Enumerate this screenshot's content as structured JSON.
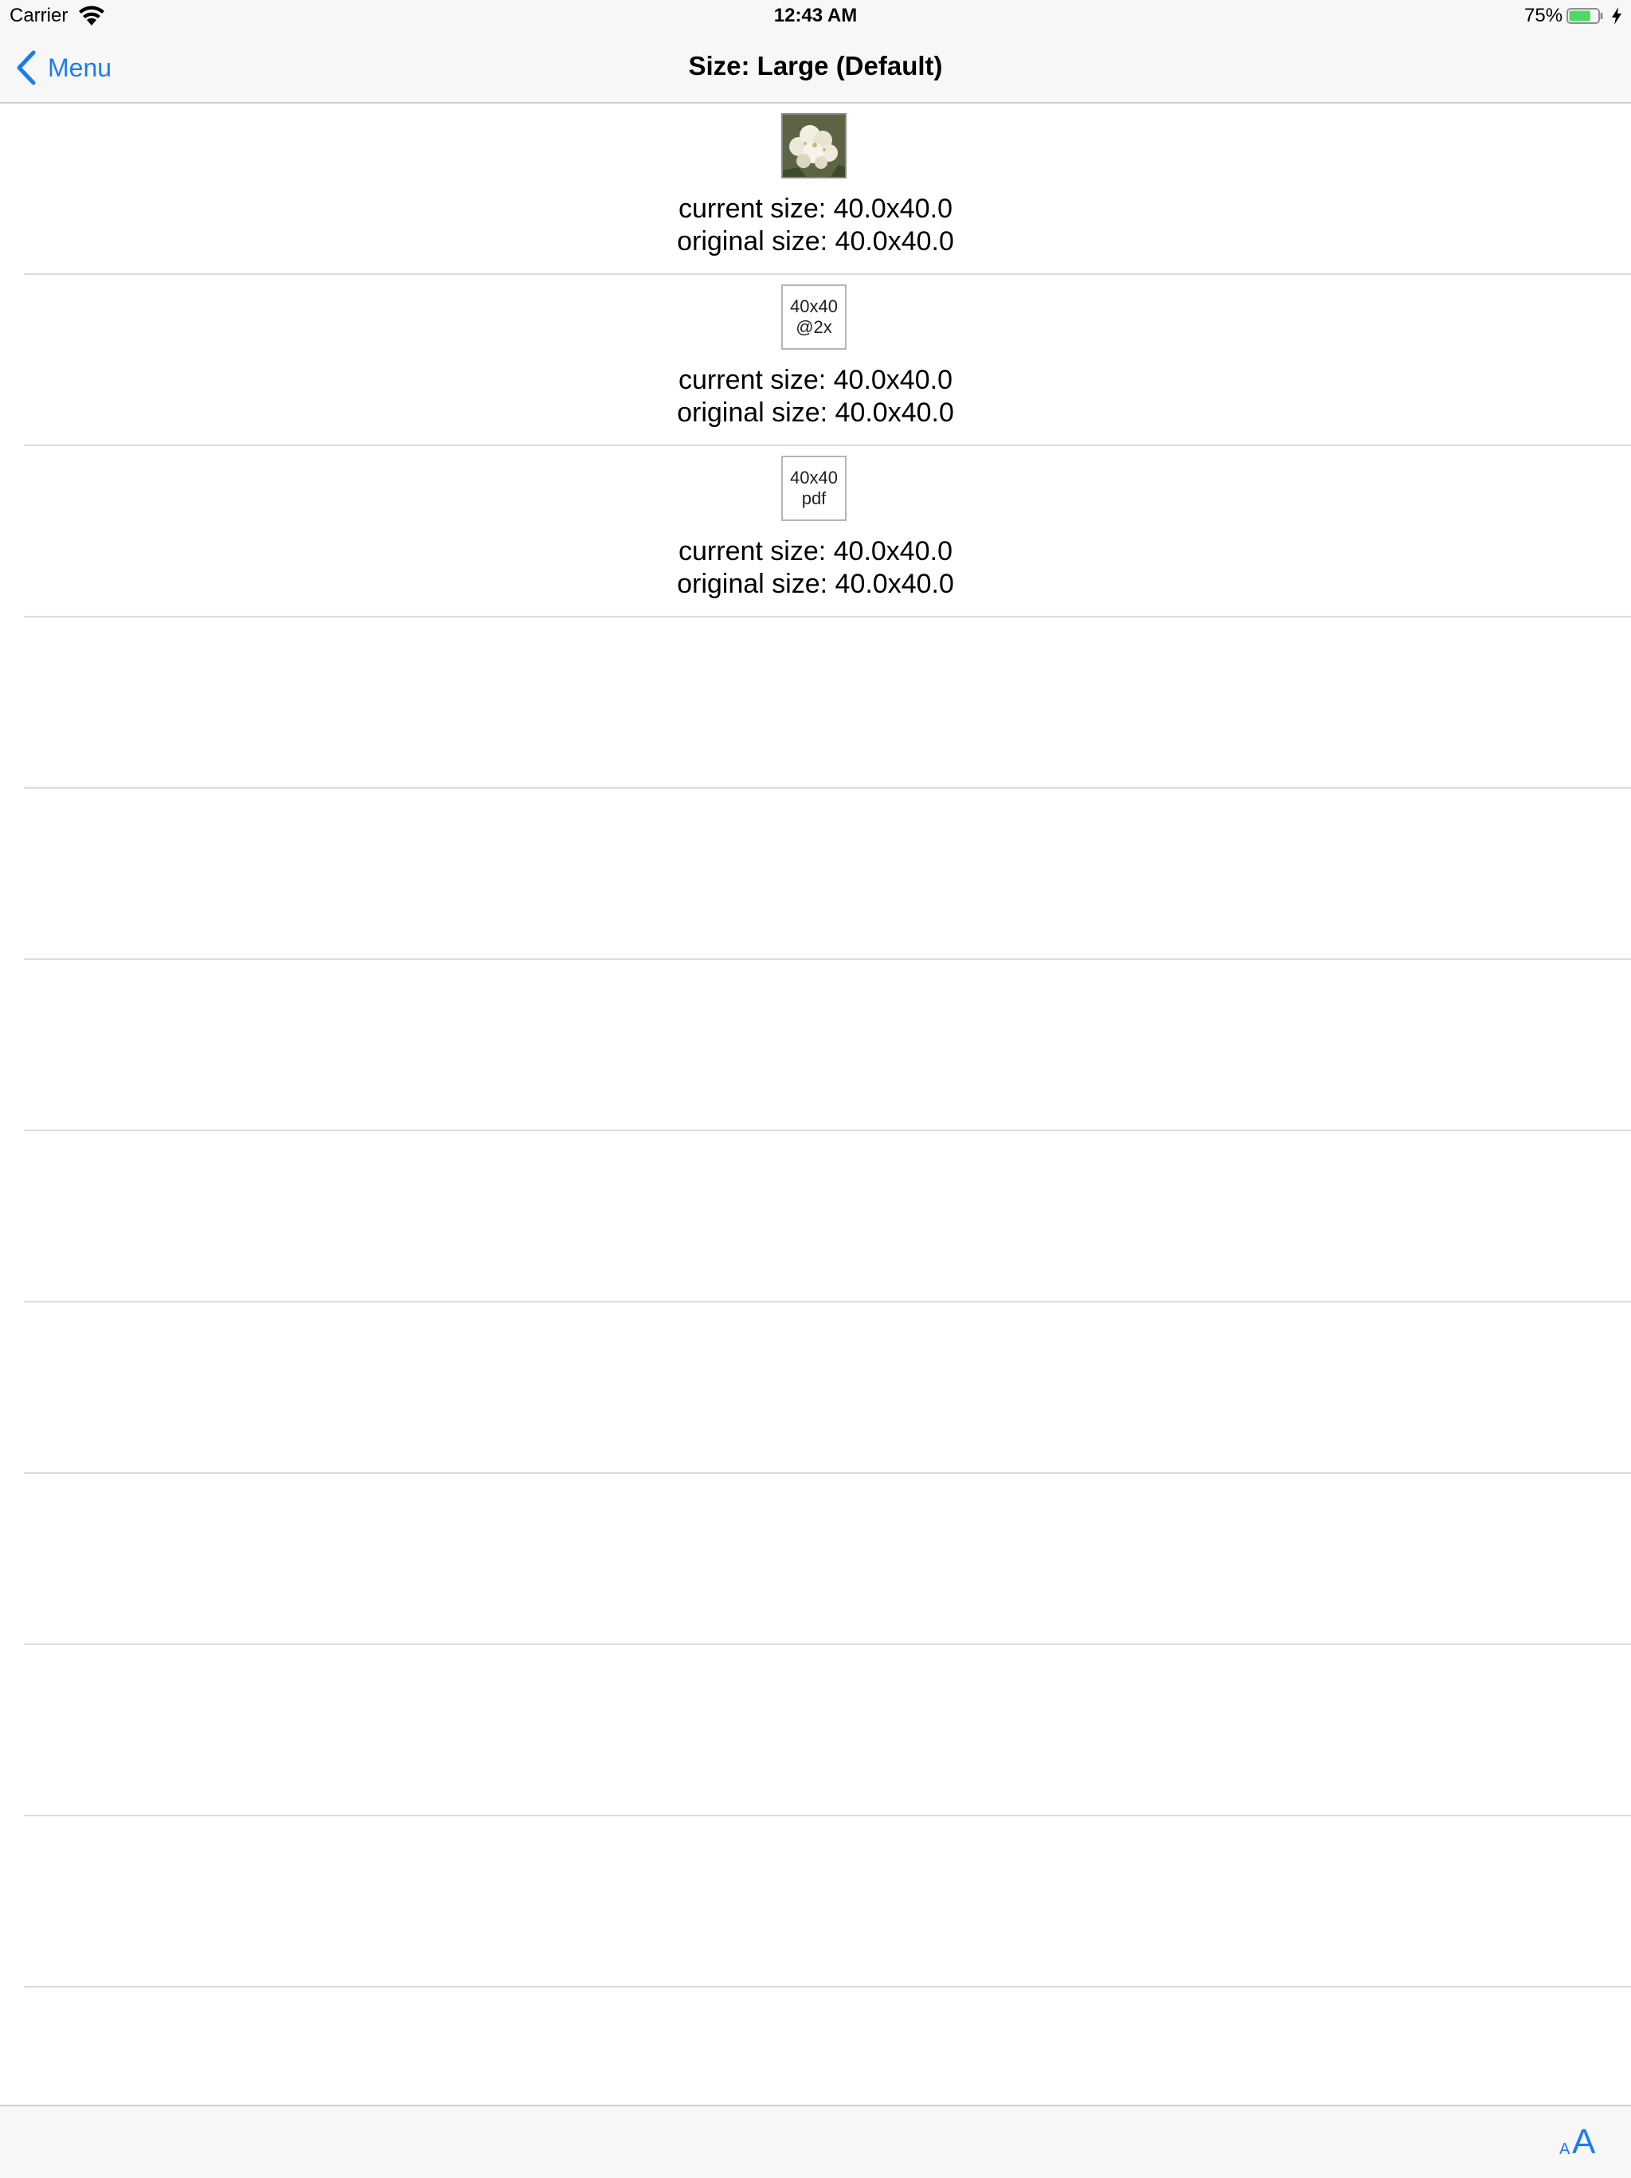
{
  "status_bar": {
    "carrier": "Carrier",
    "time": "12:43 AM",
    "battery_percent": "75%",
    "battery_level": 0.75,
    "battery_color": "#4cd964",
    "wifi_icon": "wifi-icon",
    "charging_icon": "charging-bolt-icon"
  },
  "nav": {
    "back_label": "Menu",
    "title": "Size: Large (Default)",
    "accent_color": "#1a7cf5"
  },
  "rows": [
    {
      "image": "flower photo",
      "current_size": "current size: 40.0x40.0",
      "original_size": "original size: 40.0x40.0"
    },
    {
      "image_line1": "40x40",
      "image_line2": "@2x",
      "current_size": "current size: 40.0x40.0",
      "original_size": "original size: 40.0x40.0"
    },
    {
      "image_line1": "40x40",
      "image_line2": "pdf",
      "current_size": "current size: 40.0x40.0",
      "original_size": "original size: 40.0x40.0"
    }
  ],
  "toolbar": {
    "text_size_small": "A",
    "text_size_large": "A"
  }
}
